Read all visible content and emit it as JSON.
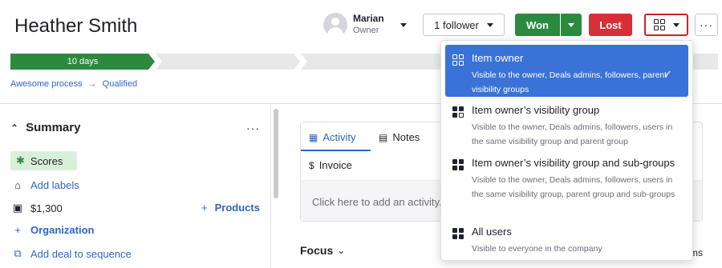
{
  "header": {
    "deal_title": "Heather Smith",
    "owner_name": "Marian",
    "owner_role": "Owner",
    "follower_label": "1 follower",
    "won_label": "Won",
    "lost_label": "Lost",
    "more_label": "···"
  },
  "pipeline": {
    "active_stage_label": "10 days",
    "breadcrumb": [
      "Awesome process",
      "Qualified"
    ]
  },
  "summary": {
    "heading": "Summary",
    "more_label": "···",
    "scores_label": "Scores",
    "add_labels": "Add labels",
    "value": "$1,300",
    "products_label": "Products",
    "organization_label": "Organization",
    "add_sequence_label": "Add deal to sequence"
  },
  "main": {
    "tabs": [
      "Activity",
      "Notes",
      "Invoice"
    ],
    "add_activity_placeholder": "Click here to add an activity...",
    "focus_label": "Focus",
    "ms_fragment": "ms"
  },
  "visibility_menu": {
    "options": [
      {
        "title": "Item owner",
        "description": "Visible to the owner, Deals admins, followers, parent visibility groups",
        "selected": true
      },
      {
        "title": "Item owner’s visibility group",
        "description": "Visible to the owner, Deals admins, followers, users in the same visibility group and parent group",
        "selected": false
      },
      {
        "title": "Item owner’s visibility group and sub-groups",
        "description": "Visible to the owner, Deals admins, followers, users in the same visibility group, parent group and sub-groups",
        "selected": false
      },
      {
        "title": "All users",
        "description": "Visible to everyone in the company",
        "selected": false
      }
    ]
  },
  "colors": {
    "won": "#2c8a3e",
    "lost": "#d62f38",
    "link": "#2f65c9",
    "selected_option": "#3a72d7",
    "highlight_border": "#d0232b"
  },
  "icons": [
    "avatar-icon",
    "caret-down-icon",
    "visibility-grid-icon",
    "more-icon",
    "chevron-up-icon",
    "scores-icon",
    "tag-icon",
    "money-icon",
    "plus-icon",
    "sequence-icon",
    "calendar-icon",
    "notes-icon",
    "invoice-icon",
    "check-icon",
    "chevron-down-icon"
  ]
}
